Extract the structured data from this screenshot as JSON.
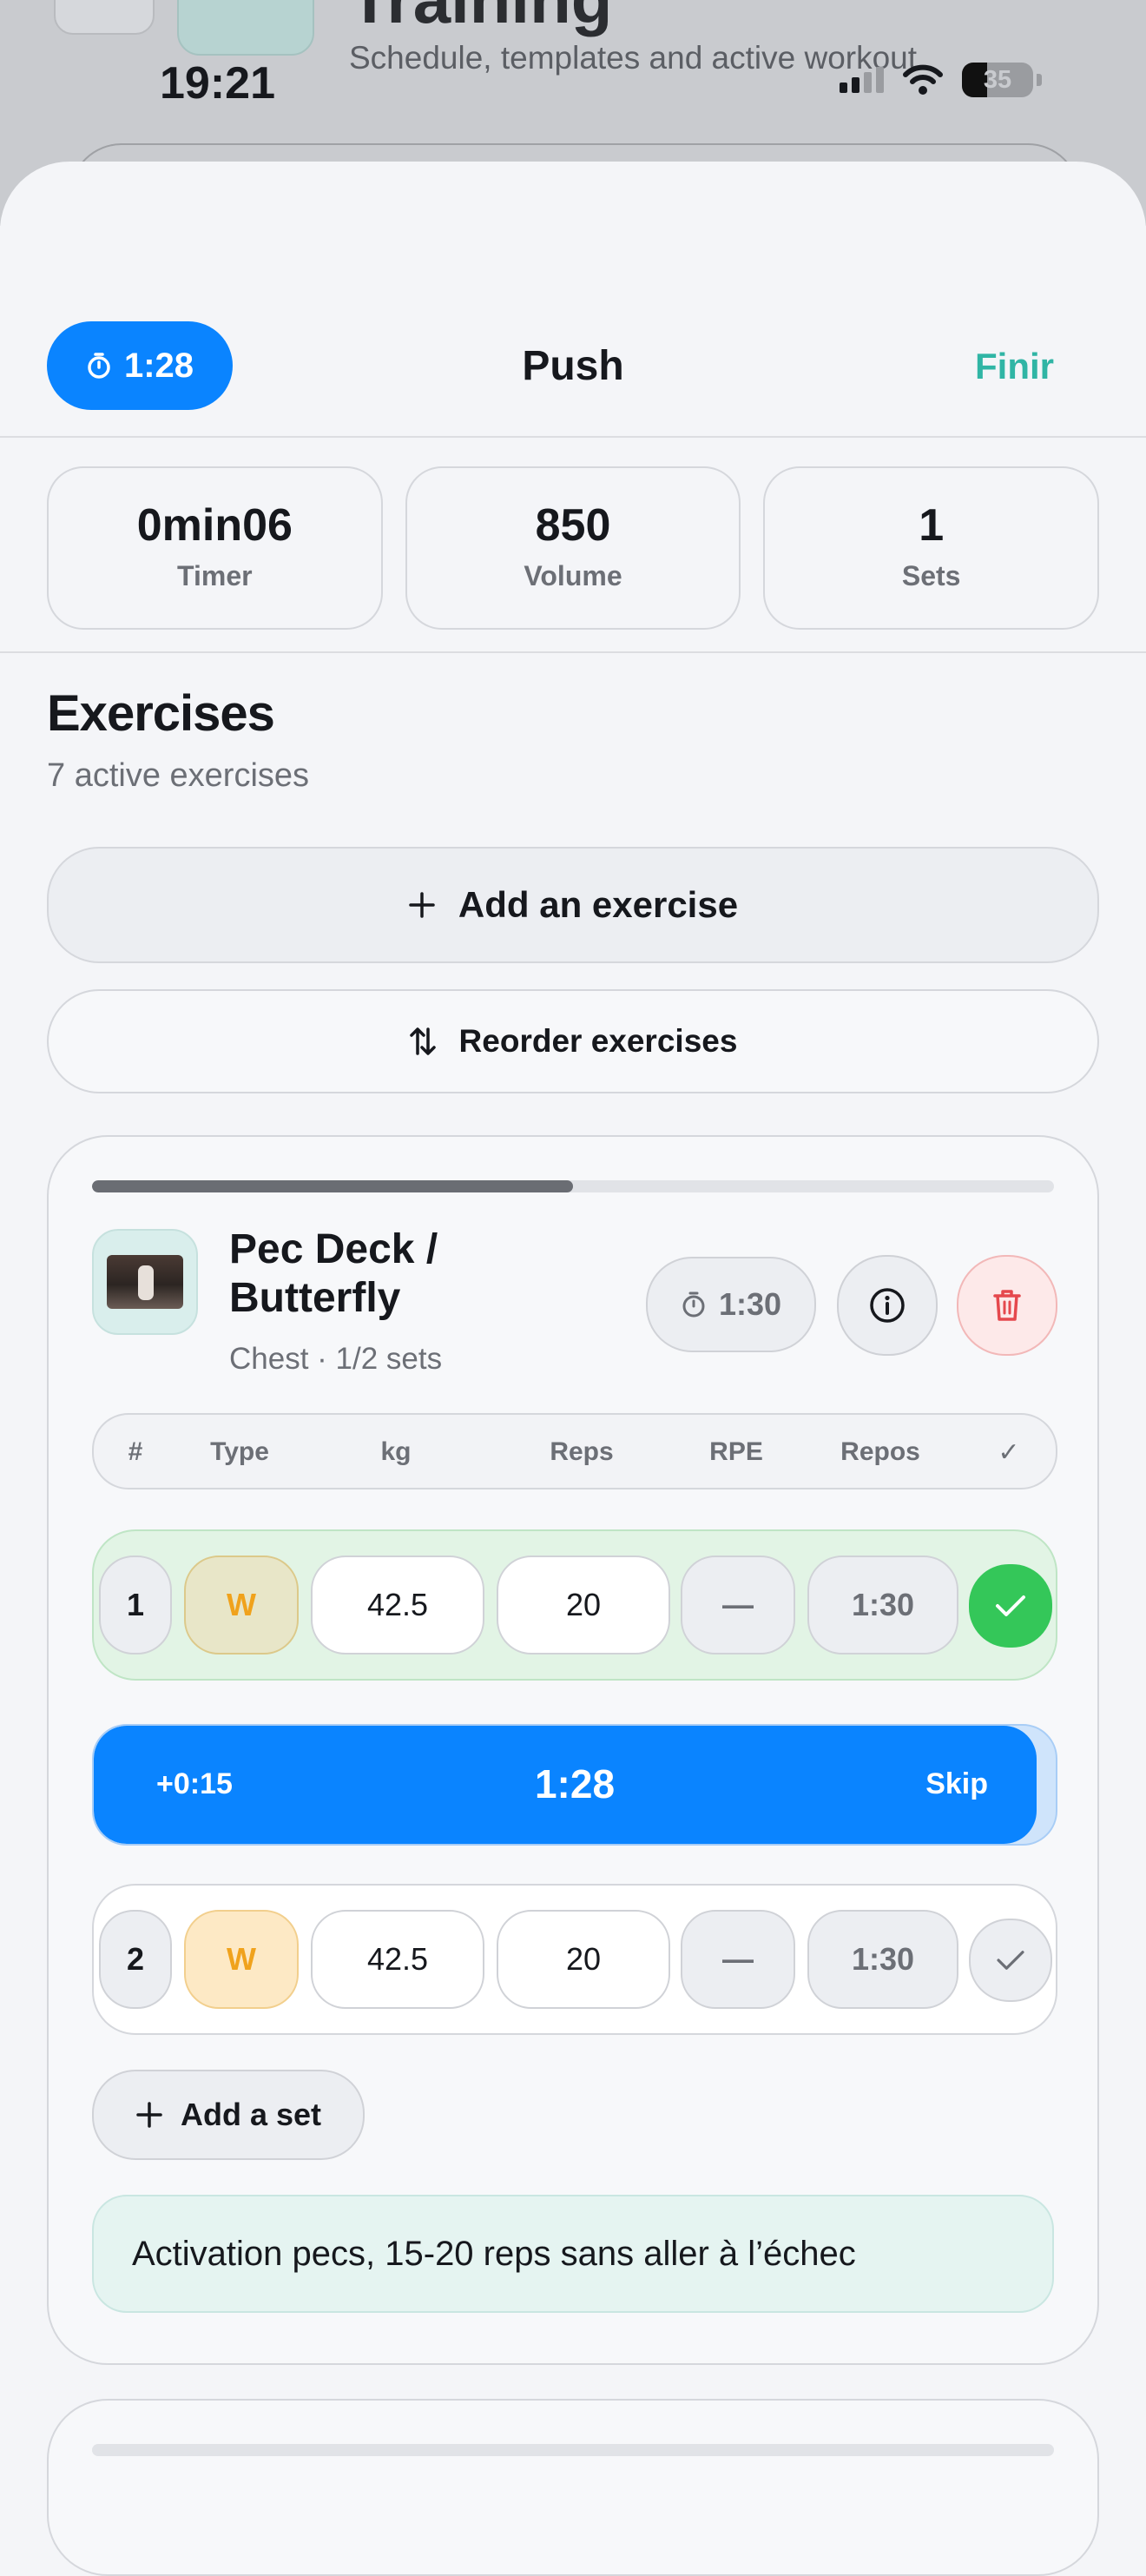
{
  "background": {
    "title": "Training",
    "subtitle": "Schedule, templates and active workout"
  },
  "status_bar": {
    "time": "19:21",
    "battery": "35",
    "battery_level": 0.35
  },
  "header": {
    "rest_timer": "1:28",
    "title": "Push",
    "finish_label": "Finir"
  },
  "stats": [
    {
      "value": "0min06",
      "label": "Timer"
    },
    {
      "value": "850",
      "label": "Volume"
    },
    {
      "value": "1",
      "label": "Sets"
    }
  ],
  "exercises_section": {
    "title": "Exercises",
    "subtitle": "7 active exercises",
    "add_label": "Add an exercise",
    "reorder_label": "Reorder exercises"
  },
  "exercise": {
    "name": "Pec Deck / Butterfly",
    "meta": "Chest · 1/2 sets",
    "progress": 0.5,
    "rest": "1:30",
    "columns": [
      "#",
      "Type",
      "kg",
      "Reps",
      "RPE",
      "Repos",
      "✓"
    ],
    "sets": [
      {
        "num": "1",
        "type": "W",
        "kg": "42.5",
        "reps": "20",
        "rpe": "—",
        "rest": "1:30",
        "done": true
      },
      {
        "num": "2",
        "type": "W",
        "kg": "42.5",
        "reps": "20",
        "rpe": "—",
        "rest": "1:30",
        "done": false
      }
    ],
    "rest_timer": {
      "add_label": "+0:15",
      "time": "1:28",
      "skip_label": "Skip",
      "progress": 0.98
    },
    "add_set_label": "Add a set",
    "note": "Activation pecs, 15-20 reps sans aller à l’échec"
  },
  "colors": {
    "accent_blue": "#0a84ff",
    "finish_teal": "#30b5a5",
    "done_green": "#34c759",
    "delete_red": "#e5484d",
    "warmup_orange": "#f0a21c"
  }
}
